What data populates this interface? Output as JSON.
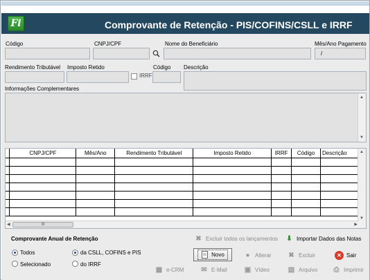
{
  "header": {
    "logo": "Fi",
    "title": "Comprovante de Retenção - PIS/COFINS/CSLL e IRRF"
  },
  "form": {
    "codigo_label": "Código",
    "cnpj_label": "CNPJ/CPF",
    "beneficiario_label": "Nome do Beneficiário",
    "mes_ano_label": "Mês/Ano Pagamento",
    "mes_ano_value": "/",
    "rendimento_label": "Rendimento Tributável",
    "imposto_label": "Imposto Retido",
    "irrf_label": "IRRF",
    "codigo2_label": "Código",
    "descricao_label": "Descrição",
    "info_label": "Informações Complementares"
  },
  "grid": {
    "columns": [
      "CNPJ/CPF",
      "Mês/Ano",
      "Rendimento Tributável",
      "Imposto Retido",
      "IRRF",
      "Código",
      "Descrição"
    ],
    "scroll_thumb": "III"
  },
  "anual": {
    "title": "Comprovante Anual de Retenção",
    "todos": "Todos",
    "selecionado": "Selecionado",
    "csll": "da CSLL, COFINS e PIS",
    "irrf": "do IRRF"
  },
  "actions": {
    "excluir_todos": "Excluir todos os lançamentos",
    "importar": "Importar Dados das Notas",
    "novo": "Novo",
    "alterar": "Alterar",
    "excluir": "Excluir",
    "sair": "Sair",
    "ecrm": "e-CRM",
    "email": "E-Mail",
    "video": "Vídeo",
    "arquivo": "Arquivo",
    "imprimir": "Imprimir"
  },
  "colors": {
    "header_bg": "#24485f",
    "logo_green": "#3aa13b",
    "exit_red": "#d83a2a"
  }
}
